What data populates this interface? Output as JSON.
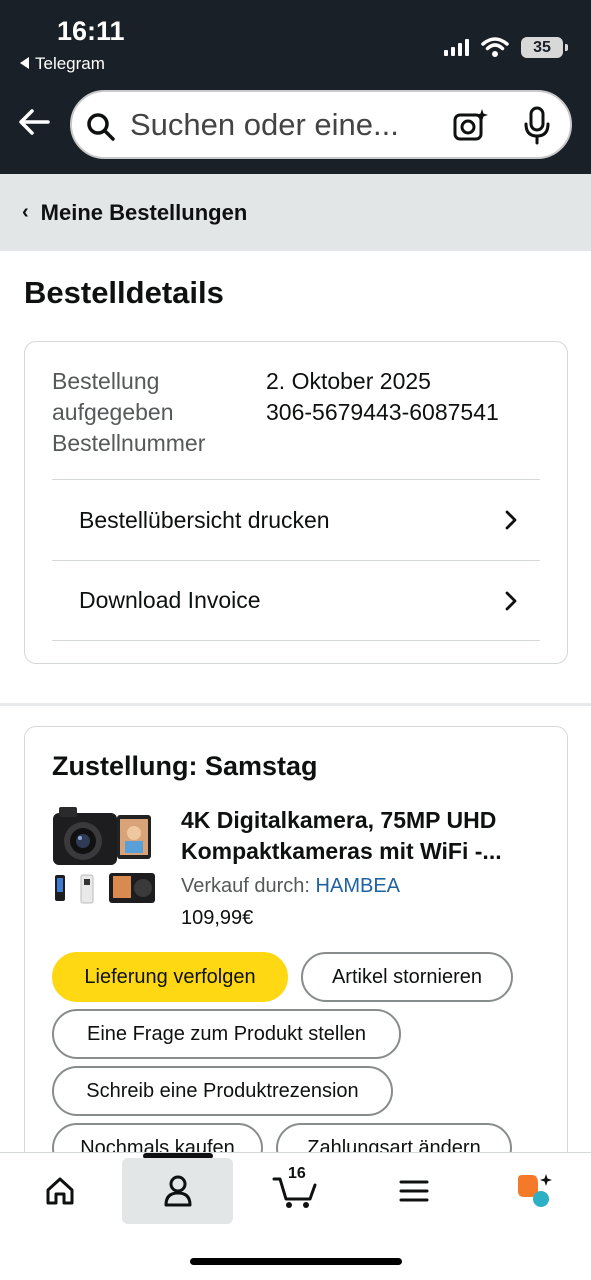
{
  "status_bar": {
    "time": "16:11",
    "back_app": "Telegram",
    "battery": "35"
  },
  "search": {
    "placeholder": "Suchen oder eine..."
  },
  "breadcrumb": {
    "label": "Meine Bestellungen"
  },
  "page": {
    "title": "Bestelldetails"
  },
  "order": {
    "placed_label_line1": "Bestellung",
    "placed_label_line2": "aufgegeben",
    "number_label": "Bestellnummer",
    "date": "2. Oktober 2025",
    "number": "306-5679443-6087541",
    "print_label": "Bestellübersicht drucken",
    "invoice_label": "Download Invoice"
  },
  "delivery": {
    "title": "Zustellung: Samstag",
    "product_title_line1": "4K Digitalkamera, 75MP UHD",
    "product_title_line2": "Kompaktkameras mit WiFi -...",
    "sold_by_label": "Verkauf durch:",
    "seller": "HAMBEA",
    "price": "109,99€",
    "buttons": {
      "track": "Lieferung verfolgen",
      "cancel": "Artikel stornieren",
      "question": "Eine Frage zum Produkt stellen",
      "review": "Schreib eine Produktrezension",
      "buy_again": "Nochmals kaufen",
      "change_payment": "Zahlungsart ändern"
    }
  },
  "bottom_nav": {
    "cart_count": "16",
    "items": [
      "home-icon",
      "profile-icon",
      "cart-icon",
      "menu-icon",
      "rufus-icon"
    ],
    "active": "profile-icon"
  },
  "colors": {
    "header_bg": "#1a2027",
    "breadcrumb_bg": "#e3e6e6",
    "primary_button": "#ffd814",
    "link": "#2162a1",
    "rufus_orange": "#f47a2a",
    "rufus_teal": "#2bb0c6"
  }
}
